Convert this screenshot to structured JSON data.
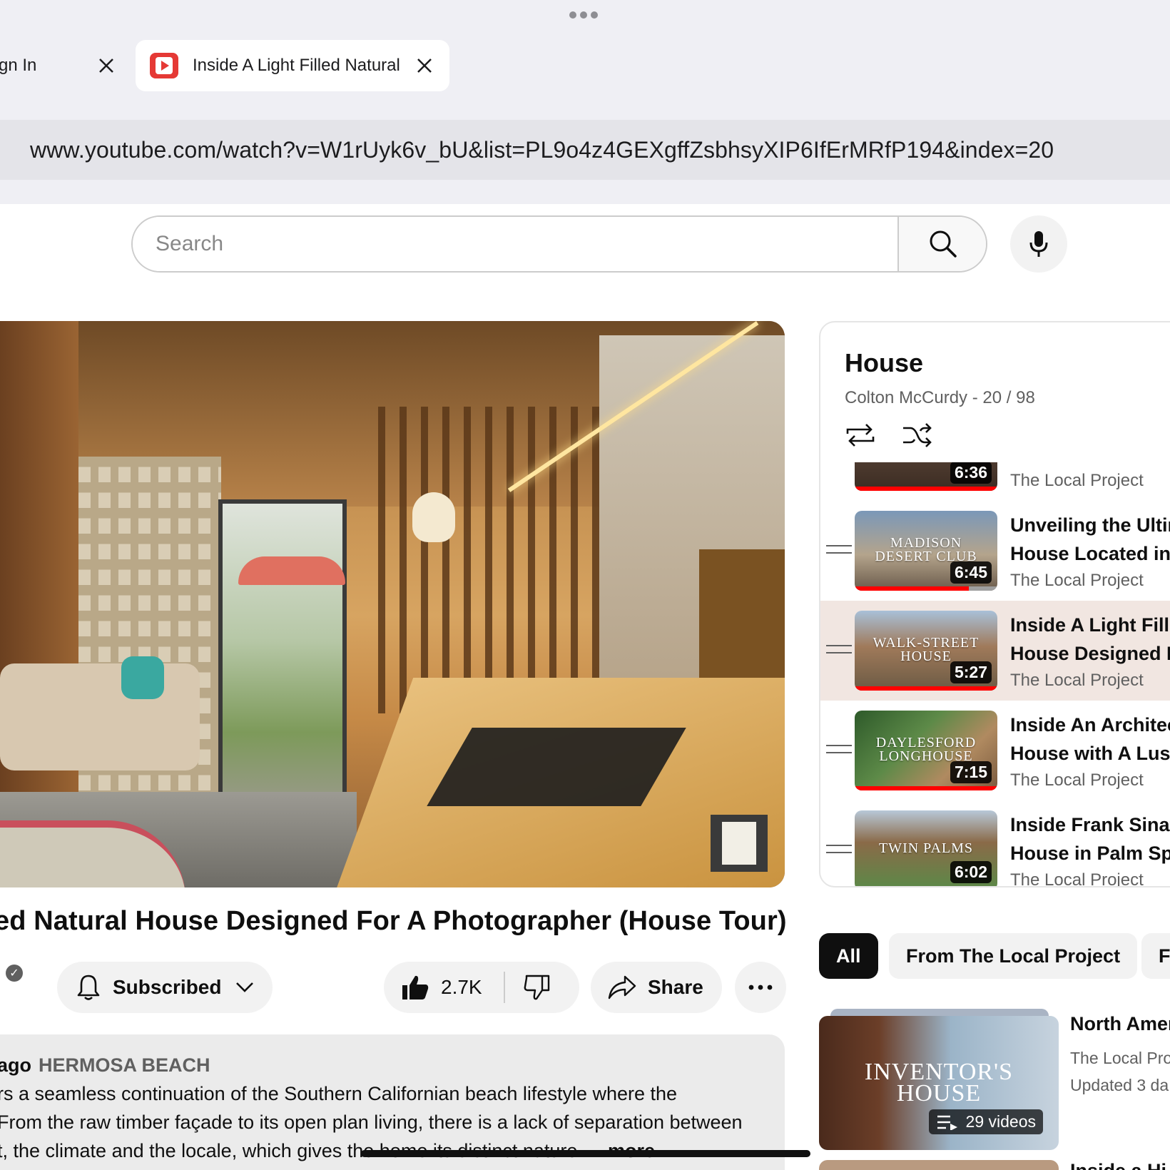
{
  "browser": {
    "tabs": [
      {
        "label": "gn In",
        "active": false
      },
      {
        "label": "Inside A Light Filled Natural",
        "active": true
      }
    ],
    "url": "www.youtube.com/watch?v=W1rUyk6v_bU&list=PL9o4z4GEXgffZsbhsyXIP6IfErMRfP194&index=20"
  },
  "header": {
    "search_placeholder": "Search"
  },
  "video": {
    "title": "ed Natural House Designed For A Photographer (House Tour)",
    "subscribe_label": "Subscribed",
    "like_count": "2.7K",
    "share_label": "Share",
    "description": {
      "time_ago": "ago",
      "location_tag": "HERMOSA BEACH",
      "lines": [
        "rs a seamless continuation of the Southern Californian beach lifestyle where the",
        "From the raw timber façade to its open plan living, there is a lack of separation between",
        "t, the climate and the locale, which gives the home its distinct nature..."
      ],
      "more_label": "more"
    }
  },
  "playlist": {
    "title": "House",
    "owner": "Colton McCurdy",
    "separator": "-",
    "position": "20 / 98",
    "items": [
      {
        "thumb_text": "",
        "duration": "6:36",
        "title1": "",
        "title2": "",
        "channel": "The Local Project",
        "progress": 1.0,
        "active": false
      },
      {
        "thumb_text": "MADISON\nDESERT CLUB",
        "duration": "6:45",
        "title1": "Unveiling the Ultim",
        "title2": "House Located in",
        "channel": "The Local Project",
        "progress": 0.8,
        "active": false
      },
      {
        "thumb_text": "WALK-STREET\nHOUSE",
        "duration": "5:27",
        "title1": "Inside A Light Fille",
        "title2": "House Designed F",
        "channel": "The Local Project",
        "progress": 1.0,
        "active": true
      },
      {
        "thumb_text": "DAYLESFORD\nLONGHOUSE",
        "duration": "7:15",
        "title1": "Inside An Architec",
        "title2": "House with A Lusc",
        "channel": "The Local Project",
        "progress": 1.0,
        "active": false
      },
      {
        "thumb_text": "TWIN PALMS",
        "duration": "6:02",
        "title1": "Inside Frank Sinatr",
        "title2": "House in Palm Spr",
        "channel": "The Local Project",
        "progress": 1.0,
        "active": false
      }
    ]
  },
  "chips": [
    "All",
    "From The Local Project",
    "F"
  ],
  "recommended": {
    "thumb_text": "INVENTOR'S\nHOUSE",
    "video_count": "29 videos",
    "title": "North Amer",
    "channel": "The Local Pro",
    "updated": "Updated 3 da",
    "next_title": "Inside a Hi"
  },
  "colors": {
    "accent_red": "#ff0000",
    "active_row": "#f1e6e1",
    "chip_active": "#0f0f0f"
  }
}
